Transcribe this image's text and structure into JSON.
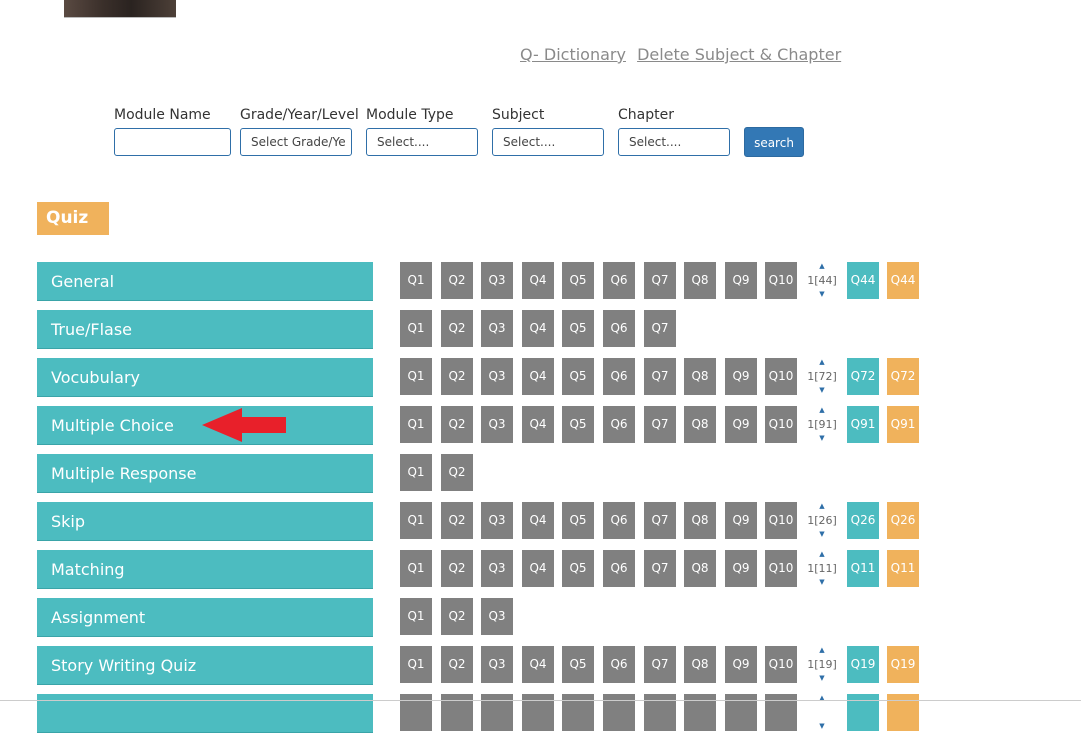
{
  "header": {
    "links": [
      "Q- Dictionary",
      "Delete Subject & Chapter"
    ]
  },
  "filters": {
    "module_name": {
      "label": "Module Name",
      "value": ""
    },
    "grade": {
      "label": "Grade/Year/Level",
      "value": "Select Grade/Ye"
    },
    "module_type": {
      "label": "Module Type",
      "value": "Select...."
    },
    "subject": {
      "label": "Subject",
      "value": "Select...."
    },
    "chapter": {
      "label": "Chapter",
      "value": "Select...."
    },
    "search_label": "search"
  },
  "section_title": "Quiz",
  "colors": {
    "teal": "#4cbcc0",
    "orange": "#f0b25c",
    "gray": "#808080",
    "blue": "#3378b5",
    "arrow": "#e8202a"
  },
  "arrow_icon": "red-left-arrow-icon",
  "categories": [
    {
      "name": "General",
      "questions": [
        "Q1",
        "Q2",
        "Q3",
        "Q4",
        "Q5",
        "Q6",
        "Q7",
        "Q8",
        "Q9",
        "Q10"
      ],
      "pager": "1[44]",
      "last": "Q44"
    },
    {
      "name": "True/Flase",
      "questions": [
        "Q1",
        "Q2",
        "Q3",
        "Q4",
        "Q5",
        "Q6",
        "Q7"
      ],
      "pager": null,
      "last": null
    },
    {
      "name": "Vocubulary",
      "questions": [
        "Q1",
        "Q2",
        "Q3",
        "Q4",
        "Q5",
        "Q6",
        "Q7",
        "Q8",
        "Q9",
        "Q10"
      ],
      "pager": "1[72]",
      "last": "Q72"
    },
    {
      "name": "Multiple Choice",
      "questions": [
        "Q1",
        "Q2",
        "Q3",
        "Q4",
        "Q5",
        "Q6",
        "Q7",
        "Q8",
        "Q9",
        "Q10"
      ],
      "pager": "1[91]",
      "last": "Q91"
    },
    {
      "name": "Multiple Response",
      "questions": [
        "Q1",
        "Q2"
      ],
      "pager": null,
      "last": null
    },
    {
      "name": "Skip",
      "questions": [
        "Q1",
        "Q2",
        "Q3",
        "Q4",
        "Q5",
        "Q6",
        "Q7",
        "Q8",
        "Q9",
        "Q10"
      ],
      "pager": "1[26]",
      "last": "Q26"
    },
    {
      "name": "Matching",
      "questions": [
        "Q1",
        "Q2",
        "Q3",
        "Q4",
        "Q5",
        "Q6",
        "Q7",
        "Q8",
        "Q9",
        "Q10"
      ],
      "pager": "1[11]",
      "last": "Q11"
    },
    {
      "name": "Assignment",
      "questions": [
        "Q1",
        "Q2",
        "Q3"
      ],
      "pager": null,
      "last": null
    },
    {
      "name": "Story Writing Quiz",
      "questions": [
        "Q1",
        "Q2",
        "Q3",
        "Q4",
        "Q5",
        "Q6",
        "Q7",
        "Q8",
        "Q9",
        "Q10"
      ],
      "pager": "1[19]",
      "last": "Q19"
    },
    {
      "name": "",
      "questions": [
        "",
        "",
        "",
        "",
        "",
        "",
        "",
        "",
        "",
        ""
      ],
      "pager": "",
      "last": ""
    }
  ]
}
